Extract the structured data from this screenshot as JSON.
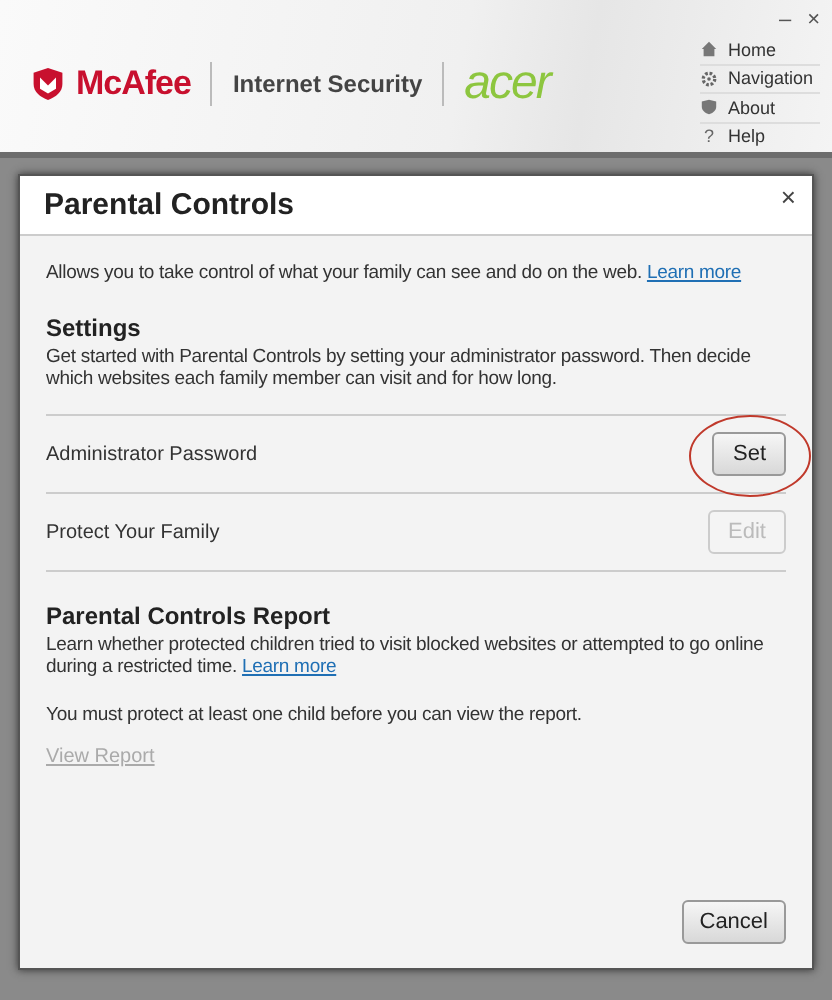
{
  "header": {
    "brand": "McAfee",
    "product": "Internet Security",
    "partner": "acer",
    "window_controls": [
      "–",
      "×"
    ],
    "nav": [
      {
        "kind": "home",
        "label": "Home"
      },
      {
        "kind": "gear",
        "label": "Navigation"
      },
      {
        "kind": "shield",
        "label": "About"
      },
      {
        "kind": "help",
        "label": "Help",
        "icon_text": "?"
      }
    ]
  },
  "dialog": {
    "title": "Parental Controls",
    "close": "×",
    "intro": "Allows you to take control of what your family can see and do on the web.",
    "intro_link": "Learn more",
    "settings": {
      "heading": "Settings",
      "description": "Get started with Parental Controls by setting your administrator password. Then decide which websites each family member can visit and for how long.",
      "rows": [
        {
          "label": "Administrator Password",
          "button": "Set",
          "disabled": false,
          "highlighted": true
        },
        {
          "label": "Protect Your Family",
          "button": "Edit",
          "disabled": true,
          "highlighted": false
        }
      ]
    },
    "report": {
      "heading": "Parental Controls Report",
      "description": "Learn whether protected children tried to visit blocked websites or attempted to go online during a restricted time.",
      "link": "Learn more",
      "note": "You must protect at least one child before you can view the report.",
      "view_link": "View Report",
      "view_disabled": true
    },
    "cancel": "Cancel"
  }
}
